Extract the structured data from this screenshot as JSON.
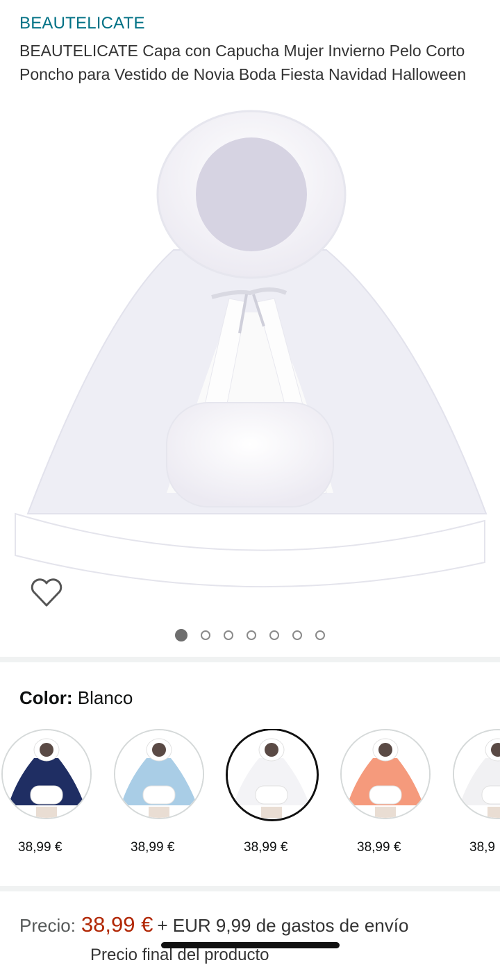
{
  "product": {
    "brand": "BEAUTELICATE",
    "title": "BEAUTELICATE Capa con Capucha Mujer Invierno Pelo Corto Poncho para Vestido de Novia Boda Fiesta Navidad Halloween"
  },
  "gallery": {
    "image_count": 7,
    "active_index": 0,
    "wishlist_icon": "heart-outline-icon"
  },
  "color": {
    "label": "Color:",
    "selected": "Blanco"
  },
  "variants": [
    {
      "price": "38,99 €",
      "cape_color": "#1f2e63",
      "selected": false
    },
    {
      "price": "38,99 €",
      "cape_color": "#a9cde6",
      "selected": false
    },
    {
      "price": "38,99 €",
      "cape_color": "#f3f3f6",
      "selected": true
    },
    {
      "price": "38,99 €",
      "cape_color": "#f59a7c",
      "selected": false
    },
    {
      "price": "38,9",
      "cape_color": "#f1f1f3",
      "selected": false
    }
  ],
  "pricing": {
    "label": "Precio:",
    "amount": "38,99 €",
    "shipping": "+ EUR 9,99 de gastos de envío",
    "final_label": "Precio final del producto"
  },
  "colors": {
    "link": "#007185",
    "price_red": "#b12704",
    "separator": "#f0f2f2"
  }
}
